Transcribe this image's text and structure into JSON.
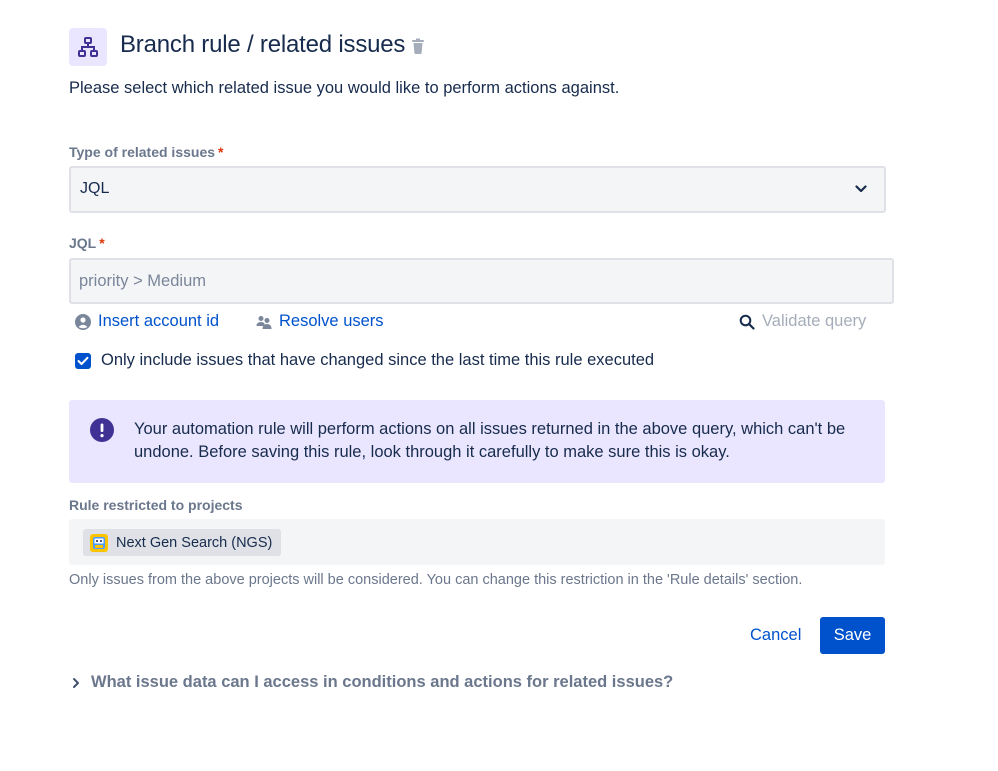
{
  "header": {
    "title": "Branch rule / related issues",
    "description": "Please select which related issue you would like to perform actions against."
  },
  "type_field": {
    "label": "Type of related issues",
    "required_mark": "*",
    "value": "JQL"
  },
  "jql_field": {
    "label": "JQL",
    "required_mark": "*",
    "placeholder": "priority > Medium",
    "value": ""
  },
  "actions": {
    "insert_account": "Insert account id",
    "resolve_users": "Resolve users",
    "validate_query": "Validate query"
  },
  "only_include": {
    "label": "Only include issues that have changed since the last time this rule executed",
    "checked": true
  },
  "warning": {
    "text": "Your automation rule will perform actions on all issues returned in the above query, which can't be undone. Before saving this rule, look through it carefully to make sure this is okay."
  },
  "restriction": {
    "label": "Rule restricted to projects",
    "projects": [
      "Next Gen Search (NGS)"
    ],
    "help": "Only issues from the above projects will be considered. You can change this restriction in the 'Rule details' section."
  },
  "buttons": {
    "cancel": "Cancel",
    "save": "Save"
  },
  "faq": {
    "label": "What issue data can I access in conditions and actions for related issues?"
  },
  "icons": {
    "branch": "branch-icon",
    "trash": "trash-icon",
    "chevron": "chevron-down-icon",
    "account": "person-icon",
    "users": "people-icon",
    "search": "search-icon",
    "check": "check-icon",
    "warning": "exclamation-icon",
    "project": "project-avatar-icon",
    "expand": "chevron-right-icon"
  },
  "colors": {
    "primary": "#0052cc",
    "warning_bg": "#eae6ff",
    "warning_icon": "#403294",
    "required": "#de350b"
  }
}
